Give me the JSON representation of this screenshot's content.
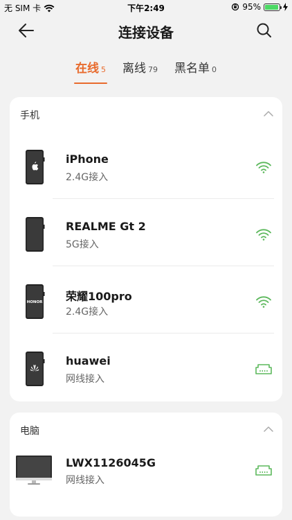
{
  "status_bar": {
    "carrier": "无 SIM 卡",
    "time": "下午2:49",
    "battery_text": "95%",
    "battery_level": 0.95
  },
  "header": {
    "title": "连接设备",
    "back_icon": "arrow-left-icon",
    "search_icon": "search-icon"
  },
  "tabs": [
    {
      "label": "在线",
      "count": "5",
      "active": true
    },
    {
      "label": "离线",
      "count": "79",
      "active": false
    },
    {
      "label": "黑名单",
      "count": "0",
      "active": false
    }
  ],
  "sections": [
    {
      "title": "手机",
      "devices": [
        {
          "name": "iPhone",
          "conn": "2.4G接入",
          "conn_icon": "wifi-icon",
          "brand": "apple"
        },
        {
          "name": "REALME Gt 2",
          "conn": "5G接入",
          "conn_icon": "wifi-icon",
          "brand": "none"
        },
        {
          "name": "荣耀100pro",
          "conn": "2.4G接入",
          "conn_icon": "wifi-icon",
          "brand": "honor",
          "brand_text": "HONOR"
        },
        {
          "name": "huawei",
          "conn": "网线接入",
          "conn_icon": "ethernet-icon",
          "brand": "huawei"
        }
      ]
    },
    {
      "title": "电脑",
      "devices": [
        {
          "name": "LWX1126045G",
          "conn": "网线接入",
          "conn_icon": "ethernet-icon"
        }
      ]
    }
  ],
  "colors": {
    "accent": "#e86a2c",
    "connection_green": "#5cb85c",
    "background": "#f2f2f2"
  }
}
